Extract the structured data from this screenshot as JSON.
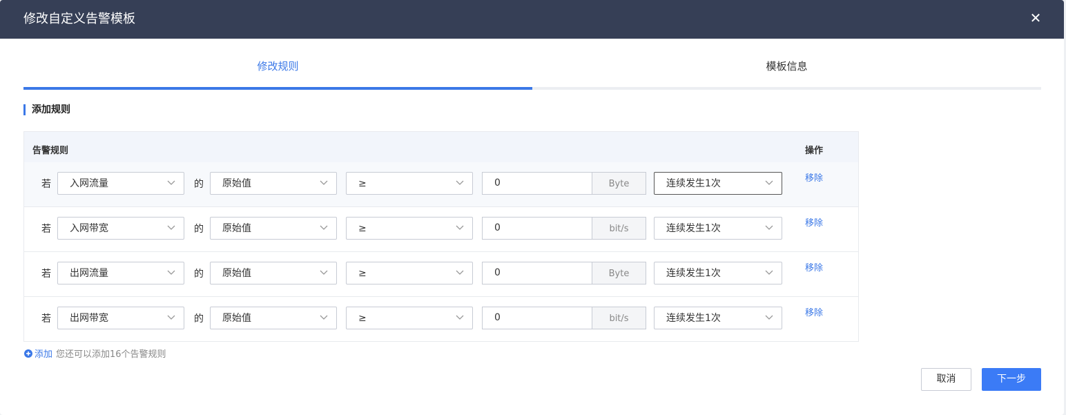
{
  "dialog": {
    "title": "修改自定义告警模板",
    "close_glyph": "✕"
  },
  "tabs": [
    {
      "label": "修改规则",
      "active": true
    },
    {
      "label": "模板信息",
      "active": false
    }
  ],
  "section_title": "添加规则",
  "table": {
    "col_rule": "告警规则",
    "col_action": "操作",
    "rows": [
      {
        "if": "若",
        "metric": "入网流量",
        "of": "的",
        "calc": "原始值",
        "operator": "≥",
        "value": "0",
        "unit": "Byte",
        "frequency": "连续发生1次",
        "remove": "移除"
      },
      {
        "if": "若",
        "metric": "入网带宽",
        "of": "的",
        "calc": "原始值",
        "operator": "≥",
        "value": "0",
        "unit": "bit/s",
        "frequency": "连续发生1次",
        "remove": "移除"
      },
      {
        "if": "若",
        "metric": "出网流量",
        "of": "的",
        "calc": "原始值",
        "operator": "≥",
        "value": "0",
        "unit": "Byte",
        "frequency": "连续发生1次",
        "remove": "移除"
      },
      {
        "if": "若",
        "metric": "出网带宽",
        "of": "的",
        "calc": "原始值",
        "operator": "≥",
        "value": "0",
        "unit": "bit/s",
        "frequency": "连续发生1次",
        "remove": "移除"
      }
    ]
  },
  "add": {
    "icon": "plus-circle-icon",
    "label": "添加",
    "hint": "您还可以添加16个告警规则"
  },
  "footer": {
    "cancel_label": "取消",
    "next_label": "下一步"
  },
  "colors": {
    "header_bg": "#363f56",
    "accent": "#3b78e7",
    "primary_button": "#3b7bf6"
  }
}
